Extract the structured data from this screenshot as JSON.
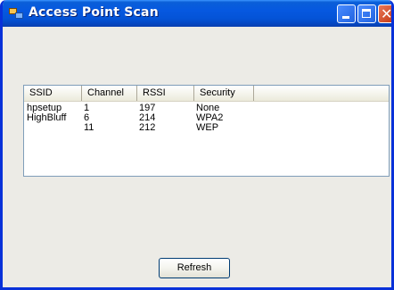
{
  "window": {
    "title": "Access Point Scan",
    "buttons": {
      "minimize": "_",
      "maximize": "□",
      "close": "✕"
    }
  },
  "list": {
    "columns": [
      "SSID",
      "Channel",
      "RSSI",
      "Security"
    ],
    "rows": [
      [
        "hpsetup",
        "1",
        "197",
        "None"
      ],
      [
        "HighBluff",
        "6",
        "214",
        "WPA2"
      ],
      [
        "",
        "11",
        "212",
        "WEP"
      ]
    ]
  },
  "refresh_label": "Refresh"
}
